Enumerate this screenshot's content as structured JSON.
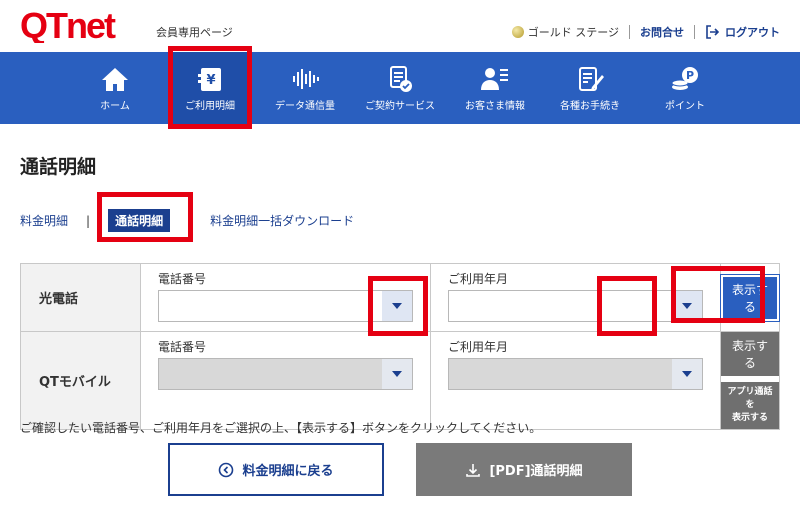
{
  "header": {
    "logo_text": "QTnet",
    "logo_sub": "会員専用ページ",
    "stage": "ゴールド ステージ",
    "contact": "お問合せ",
    "logout": "ログアウト"
  },
  "nav": {
    "items": [
      {
        "label": "ホーム",
        "icon": "home-icon"
      },
      {
        "label": "ご利用明細",
        "icon": "bill-icon"
      },
      {
        "label": "データ通信量",
        "icon": "data-wave-icon"
      },
      {
        "label": "ご契約サービス",
        "icon": "contract-icon"
      },
      {
        "label": "お客さま情報",
        "icon": "user-info-icon"
      },
      {
        "label": "各種お手続き",
        "icon": "procedure-icon"
      },
      {
        "label": "ポイント",
        "icon": "point-icon"
      }
    ]
  },
  "page": {
    "title": "通話明細"
  },
  "subnav": {
    "fee": "料金明細",
    "call": "通話明細",
    "bulk": "料金明細一括ダウンロード",
    "separator": "|"
  },
  "form": {
    "rows": [
      {
        "head": "光電話",
        "phone_label": "電話番号",
        "phone_value": "",
        "month_label": "ご利用年月",
        "month_value": "",
        "show_label": "表示する"
      },
      {
        "head": "QTモバイル",
        "phone_label": "電話番号",
        "phone_value": "",
        "month_label": "ご利用年月",
        "month_value": "",
        "show_label": "表示する",
        "app_label_1": "アプリ通話を",
        "app_label_2": "表示する"
      }
    ]
  },
  "note": "ご確認したい電話番号、ご利用年月をご選択の上、【表示する】ボタンをクリックしてください。",
  "actions": {
    "back": "料金明細に戻る",
    "pdf": "[PDF]通話明細"
  },
  "colors": {
    "nav_bg": "#2a5fbf",
    "brand_red": "#e50012",
    "link_navy": "#1b3f8f",
    "highlight": "#e50012"
  }
}
